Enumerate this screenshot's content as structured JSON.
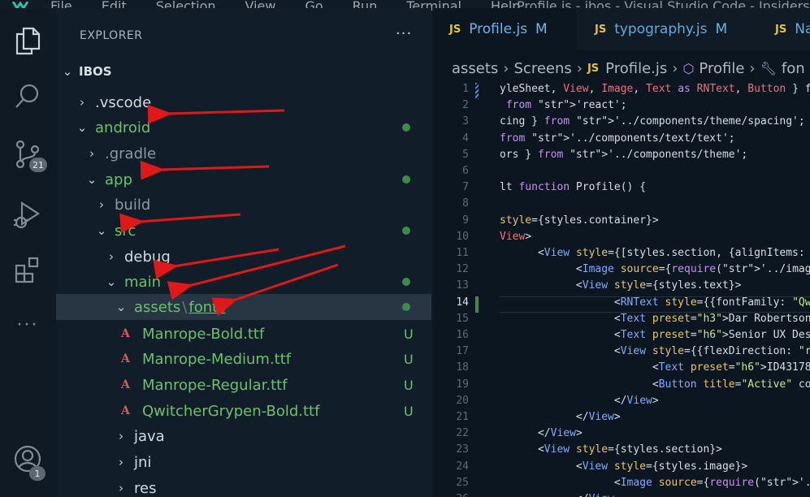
{
  "titlebar": {
    "menu": [
      "File",
      "Edit",
      "Selection",
      "View",
      "Go",
      "Run",
      "Terminal",
      "Help"
    ],
    "window_title": "Profile.js - ibos - Visual Studio Code - Insiders"
  },
  "activity_bar": {
    "source_control_badge": "21",
    "accounts_badge": "1",
    "more_label": "···"
  },
  "explorer": {
    "header": "EXPLORER",
    "more": "···",
    "root": "IBOS",
    "items": [
      {
        "label": ".vscode",
        "chevron": "›",
        "color": "white"
      },
      {
        "label": "android",
        "chevron": "⌄",
        "color": "green",
        "dot": true
      },
      {
        "label": ".gradle",
        "chevron": "›",
        "color": "dim"
      },
      {
        "label": "app",
        "chevron": "⌄",
        "color": "green",
        "dot": true
      },
      {
        "label": "build",
        "chevron": "›",
        "color": "dim"
      },
      {
        "label": "src",
        "chevron": "⌄",
        "color": "green",
        "dot": true
      },
      {
        "label": "debug",
        "chevron": "›",
        "color": "white"
      },
      {
        "label": "main",
        "chevron": "⌄",
        "color": "green",
        "dot": true
      },
      {
        "label": "assets",
        "label2": "fonts",
        "separator": "\\",
        "chevron": "⌄",
        "color": "green",
        "dot": true
      },
      {
        "label": "Manrope-Bold.ttf",
        "status": "U"
      },
      {
        "label": "Manrope-Medium.ttf",
        "status": "U"
      },
      {
        "label": "Manrope-Regular.ttf",
        "status": "U"
      },
      {
        "label": "QwitcherGrypen-Bold.ttf",
        "status": "U"
      },
      {
        "label": "java",
        "chevron": "›",
        "color": "white"
      },
      {
        "label": "jni",
        "chevron": "›",
        "color": "white"
      },
      {
        "label": "res",
        "chevron": "›",
        "color": "white"
      }
    ],
    "font_icon": "A"
  },
  "tabs": [
    {
      "js": "JS",
      "name": "Profile.js",
      "flag": "M",
      "active": true
    },
    {
      "js": "JS",
      "name": "typography.js",
      "flag": "M",
      "active": false
    },
    {
      "js": "JS",
      "name": "Na",
      "flag": "",
      "active": false
    }
  ],
  "breadcrumb": {
    "parts": [
      "assets",
      "Screens"
    ],
    "file_js": "JS",
    "file": "Profile.js",
    "symbol": "Profile",
    "symbol2": "fon"
  },
  "code": {
    "current_line": 14,
    "lines": [
      {
        "n": "1",
        "t": "yleSheet, View, Image, Text as RNText, Button } f"
      },
      {
        "n": "2",
        "t": " from 'react';"
      },
      {
        "n": "3",
        "t": "cing } from '../components/theme/spacing';"
      },
      {
        "n": "4",
        "t": "from '../components/text/text';"
      },
      {
        "n": "5",
        "t": "ors } from '../components/theme';"
      },
      {
        "n": "6",
        "t": ""
      },
      {
        "n": "7",
        "t": "lt function Profile() {"
      },
      {
        "n": "8",
        "t": ""
      },
      {
        "n": "9",
        "t": "style={styles.container}>"
      },
      {
        "n": "10",
        "t": "View>"
      },
      {
        "n": "11",
        "t": "      <View style={[styles.section, {alignItems:"
      },
      {
        "n": "12",
        "t": "            <Image source={require('../image/wome"
      },
      {
        "n": "13",
        "t": "            <View style={styles.text}>"
      },
      {
        "n": "14",
        "t": "                  <RNText style={{fontFamily: \"Qw"
      },
      {
        "n": "15",
        "t": "                  <Text preset=\"h3\">Dar Robertson"
      },
      {
        "n": "16",
        "t": "                  <Text preset=\"h6\">Senior UX Des"
      },
      {
        "n": "17",
        "t": "                  <View style={{flexDirection: \"r"
      },
      {
        "n": "18",
        "t": "                        <Text preset=\"h6\">ID43178"
      },
      {
        "n": "19",
        "t": "                        <Button title=\"Active\" co"
      },
      {
        "n": "20",
        "t": "                  </View>"
      },
      {
        "n": "21",
        "t": "            </View>"
      },
      {
        "n": "22",
        "t": "      </View>"
      },
      {
        "n": "23",
        "t": "      <View style={styles.section}>"
      },
      {
        "n": "24",
        "t": "            <View style={styles.image}>"
      },
      {
        "n": "25",
        "t": "                  <Image source={require('../imag"
      },
      {
        "n": "26",
        "t": "            </View"
      }
    ]
  },
  "colors": {
    "annotation_arrow": "#e01818",
    "git_added_green": "#6cc06c",
    "js_yellow": "#e2c33a",
    "tab_blue": "#6fb3e8"
  }
}
